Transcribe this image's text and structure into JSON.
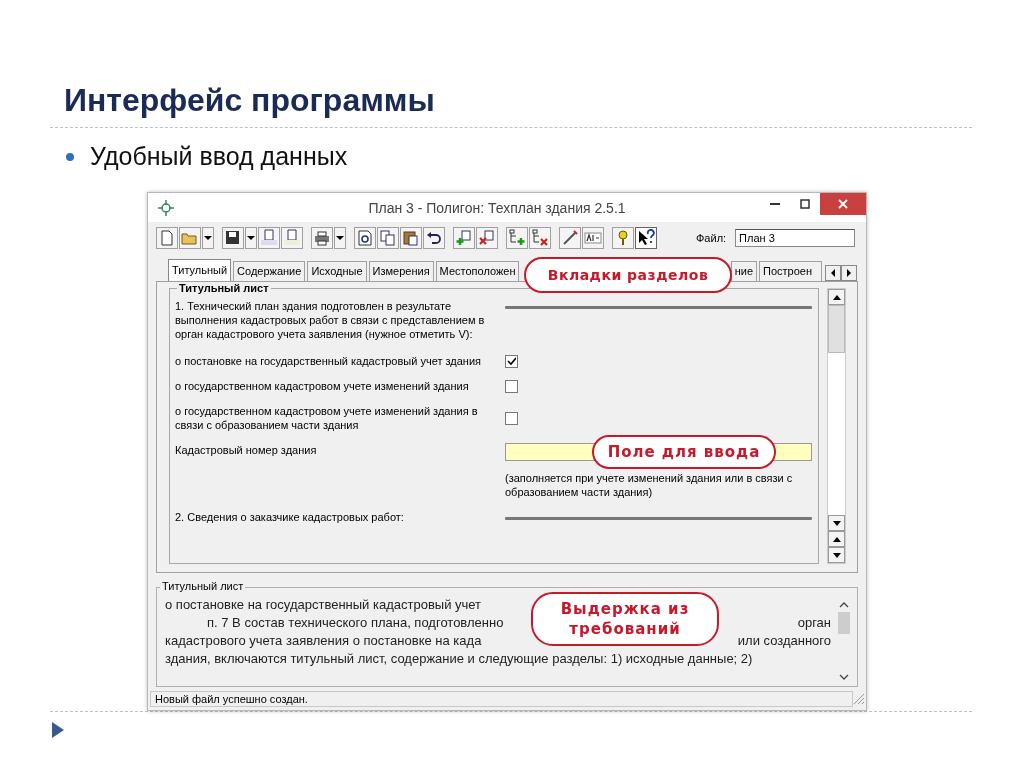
{
  "slide": {
    "title": "Интерфейс программы",
    "bullets": [
      "Удобный ввод данных"
    ]
  },
  "window": {
    "title": "План 3 - Полигон: Техплан здания 2.5.1"
  },
  "toolbar": {
    "file_label": "Файл:",
    "file_value": "План 3"
  },
  "tabs": [
    {
      "label": "Титульный",
      "selected": true,
      "kind": "whole"
    },
    {
      "label": "Содержание",
      "selected": false,
      "kind": "whole"
    },
    {
      "label": "Исходные",
      "selected": false,
      "kind": "whole"
    },
    {
      "label": "Измерения",
      "selected": false,
      "kind": "whole"
    },
    {
      "label": "Местоположен",
      "selected": false,
      "kind": "cut_right"
    },
    {
      "label": "ние",
      "selected": false,
      "kind": "cut_left"
    },
    {
      "label": "Построен",
      "selected": false,
      "kind": "cut_right"
    }
  ],
  "group": {
    "title": "Титульный лист",
    "rows": [
      {
        "kind": "heading",
        "label": "1. Технический план здания подготовлен в результате выполнения кадастровых работ в связи с представлением в орган кадастрового учета заявления (нужное отметить V):"
      },
      {
        "kind": "checkbox",
        "label": "о постановке на государственный кадастровый учет здания",
        "checked": true
      },
      {
        "kind": "checkbox",
        "label": "о государственном кадастровом учете изменений здания",
        "checked": false
      },
      {
        "kind": "checkbox",
        "label": "о государственном кадастровом учете изменений здания в связи с образованием части здания",
        "checked": false
      },
      {
        "kind": "field",
        "label": "Кадастровый номер здания",
        "hint": "(заполняется при учете изменений здания или в связи с образованием части здания)"
      },
      {
        "kind": "heading",
        "label": "2. Сведения о заказчике кадастровых работ:"
      }
    ]
  },
  "excerpt": {
    "title": "Титульный лист",
    "lines": [
      {
        "kind": "plain",
        "left": "о постановке на государственный кадастровый учет"
      },
      {
        "kind": "indent",
        "left": "п. 7 В состав технического плана, подготовленно",
        "right": "орган"
      },
      {
        "kind": "plain",
        "left": "кадастрового учета заявления о постановке на када",
        "right": "или созданного"
      },
      {
        "kind": "plain",
        "left": "здания, включаются титульный лист, содержание и следующие разделы: 1) исходные данные; 2)"
      }
    ]
  },
  "status_bar": "Новый файл успешно создан.",
  "callouts": [
    {
      "kind": "tabs",
      "text": "Вкладки разделов"
    },
    {
      "kind": "field",
      "text": "Поле для ввода"
    },
    {
      "kind": "excerpt",
      "text": "Выдержка из требований"
    }
  ]
}
